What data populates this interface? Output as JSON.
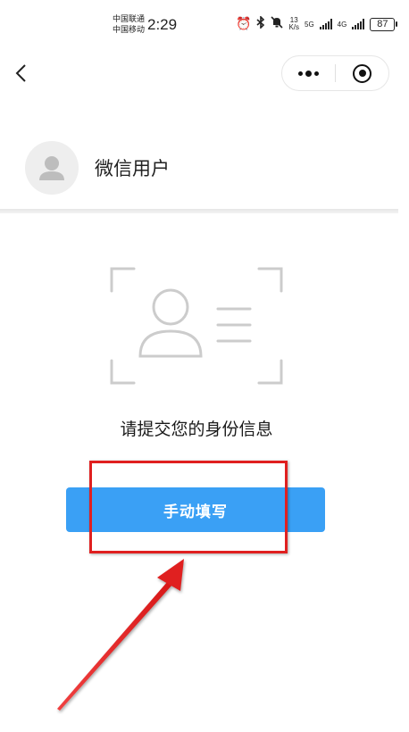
{
  "status_bar": {
    "carrier_1": "中国联通",
    "carrier_2": "中国移动",
    "time": "2:29",
    "alarm_icon": "alarm-icon",
    "bluetooth_icon": "bluetooth-icon",
    "mute_icon": "bell-off-icon",
    "speed_value": "13",
    "speed_unit": "K/s",
    "network_1": "5G",
    "network_2": "4G",
    "battery": "87"
  },
  "nav": {
    "back_icon": "chevron-left-icon",
    "more_icon": "more-dots-icon",
    "close_icon": "target-circle-icon"
  },
  "user": {
    "avatar_icon": "user-avatar-icon",
    "name": "微信用户"
  },
  "content": {
    "illustration_icon": "id-card-scan-icon",
    "prompt": "请提交您的身份信息",
    "manual_fill_button": "手动填写"
  },
  "colors": {
    "accent": "#3aa0f5",
    "annotation": "#e02020",
    "illustration": "#cccccc"
  }
}
